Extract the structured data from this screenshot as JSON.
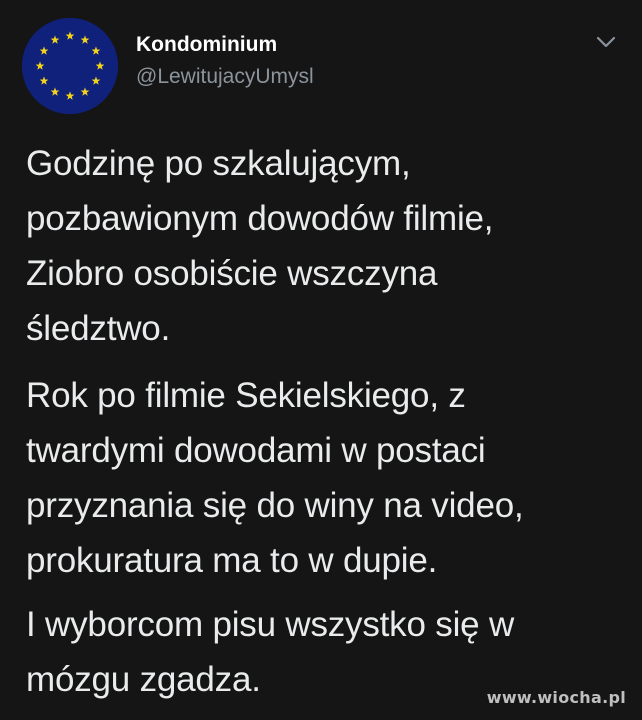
{
  "tweet": {
    "author_name": "Kondominium",
    "author_handle": "@LewitujacyUmysl",
    "avatar_icon": "eu-flag-avatar-icon",
    "menu_icon": "chevron-down-icon",
    "paragraphs": [
      "Godzinę po szkalującym,\npozbawionym dowodów filmie,\nZiobro osobiście wszczyna\nśledztwo.",
      "Rok po filmie Sekielskiego, z\ntwardymi dowodami w postaci\nprzyznania się do winy na video,\nprokuratura ma to w dupie.",
      "I wyborcom pisu wszystko się w\nmózgu zgadza."
    ]
  },
  "watermark": "www.wiocha.pl",
  "colors": {
    "background": "#151515",
    "text": "#e9ebec",
    "handle": "#8b949c",
    "avatar_blue": "#10217c",
    "star_yellow": "#f2d21b"
  }
}
